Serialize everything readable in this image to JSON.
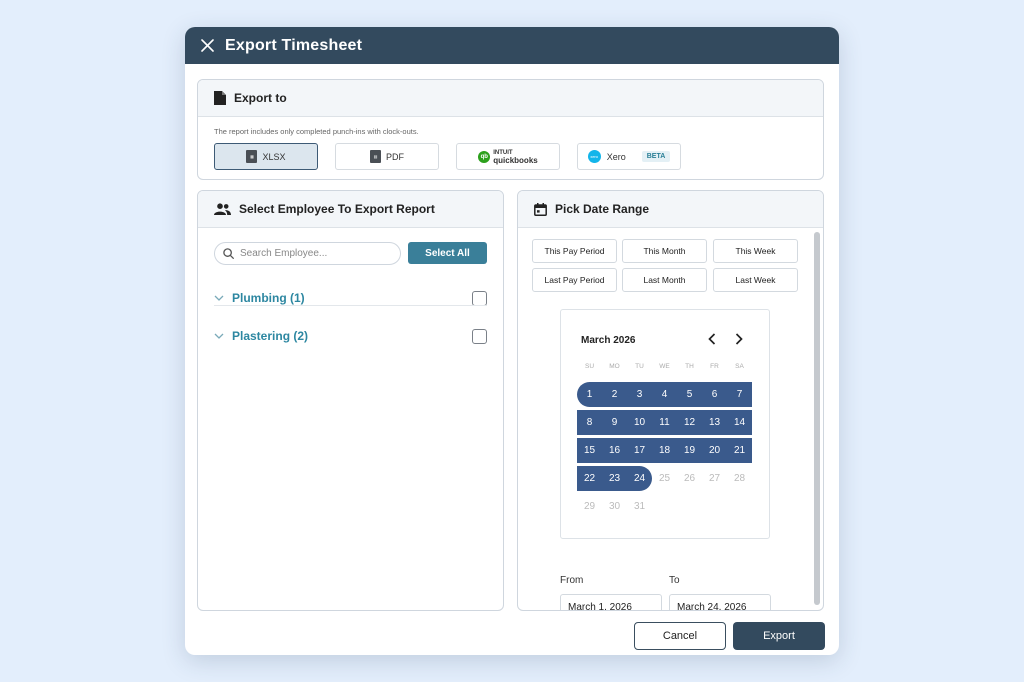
{
  "modal": {
    "title": "Export Timesheet"
  },
  "export_to": {
    "heading": "Export to",
    "note": "The report includes only completed punch-ins with clock-outs.",
    "formats": [
      {
        "label": "XLSX",
        "icon": "spreadsheet-file-icon",
        "selected": true
      },
      {
        "label": "PDF",
        "icon": "pdf-file-icon",
        "selected": false
      },
      {
        "label_top": "INTUIT",
        "label_bottom": "quickbooks",
        "logo": "qb",
        "selected": false
      },
      {
        "label": "Xero",
        "logo": "xero",
        "badge": "BETA",
        "selected": false
      }
    ]
  },
  "employees": {
    "heading": "Select Employee To Export Report",
    "search_placeholder": "Search Employee...",
    "select_all": "Select All",
    "groups": [
      {
        "name": "Plumbing (1)"
      },
      {
        "name": "Plastering (2)"
      }
    ]
  },
  "date_range": {
    "heading": "Pick Date Range",
    "presets": [
      "This Pay Period",
      "This Month",
      "This Week",
      "Last Pay Period",
      "Last Month",
      "Last Week"
    ],
    "calendar": {
      "month": "March 2026",
      "weekdays": [
        "SU",
        "MO",
        "TU",
        "WE",
        "TH",
        "FR",
        "SA"
      ],
      "first_weekday_index": 0,
      "days_in_month": 31,
      "selected_start": 1,
      "selected_end": 24
    },
    "from_label": "From",
    "to_label": "To",
    "from_value": "March 1, 2026",
    "to_value": "March 24, 2026"
  },
  "footer": {
    "cancel": "Cancel",
    "export": "Export"
  },
  "colors": {
    "header": "#334a5e",
    "accent": "#3a7f99",
    "range": "#3a5a8c",
    "group_text": "#2d87a1"
  }
}
